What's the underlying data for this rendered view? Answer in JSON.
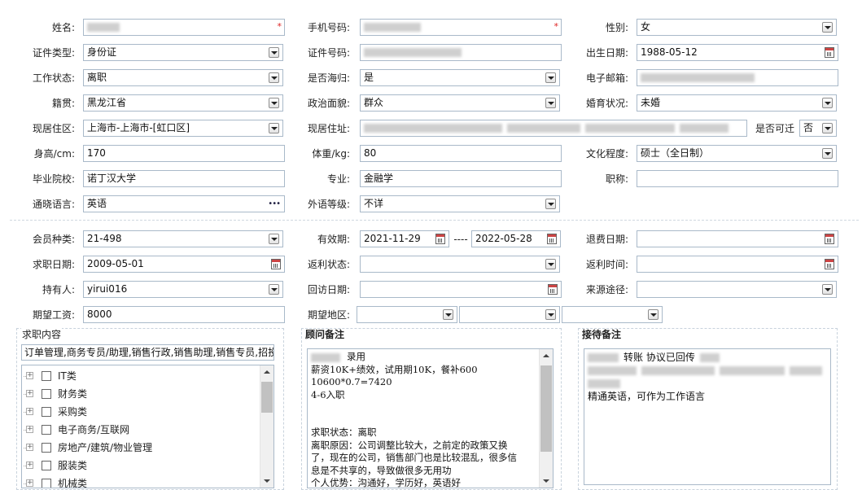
{
  "personal": {
    "name_label": "姓名:",
    "phone_label": "手机号码:",
    "gender_label": "性别:",
    "gender_value": "女",
    "id_type_label": "证件类型:",
    "id_type_value": "身份证",
    "id_number_label": "证件号码:",
    "birth_label": "出生日期:",
    "birth_value": "1988-05-12",
    "work_status_label": "工作状态:",
    "work_status_value": "离职",
    "returnee_label": "是否海归:",
    "returnee_value": "是",
    "email_label": "电子邮箱:",
    "native_label": "籍贯:",
    "native_value": "黑龙江省",
    "political_label": "政治面貌:",
    "political_value": "群众",
    "marital_label": "婚育状况:",
    "marital_value": "未婚",
    "residence_label": "现居住区:",
    "residence_value": "上海市-上海市-[虹口区]",
    "address_label": "现居住址:",
    "relocate_label": "是否可迁",
    "relocate_value": "否",
    "height_label": "身高/cm:",
    "height_value": "170",
    "weight_label": "体重/kg:",
    "weight_value": "80",
    "education_label": "文化程度:",
    "education_value": "硕士（全日制）",
    "school_label": "毕业院校:",
    "school_value": "诺丁汉大学",
    "major_label": "专业:",
    "major_value": "金融学",
    "title_label": "职称:",
    "language_label": "通晓语言:",
    "language_value": "英语",
    "language_more": "•••",
    "foreign_level_label": "外语等级:",
    "foreign_level_value": "不详"
  },
  "membership": {
    "type_label": "会员种类:",
    "type_value": "21-498",
    "valid_label": "有效期:",
    "valid_from": "2021-11-29",
    "valid_sep": "----",
    "valid_to": "2022-05-28",
    "refund_label": "退费日期:",
    "job_date_label": "求职日期:",
    "job_date_value": "2009-05-01",
    "rebate_status_label": "返利状态:",
    "rebate_time_label": "返利时间:",
    "holder_label": "持有人:",
    "holder_value": "yirui016",
    "revisit_label": "回访日期:",
    "source_label": "来源途径:",
    "salary_label": "期望工资:",
    "salary_value": "8000",
    "region_label": "期望地区:"
  },
  "job_panel": {
    "title": "求职内容",
    "selected": "订单管理,商务专员/助理,销售行政,销售助理,销售专员,招投",
    "categories": [
      "IT类",
      "财务类",
      "采购类",
      "电子商务/互联网",
      "房地产/建筑/物业管理",
      "服装类",
      "机械类"
    ]
  },
  "consultant_panel": {
    "title": "顾问备注",
    "line1_suffix": "录用",
    "lines": [
      "薪资10K+绩效，试用期10K，餐补600",
      "10600*0.7=7420",
      "4-6入职",
      "",
      "",
      "求职状态：离职",
      "离职原因：公司调整比较大，之前定的政策又换",
      "了，现在的公司，销售部门也是比较混乱，很多信",
      "息是不共享的，导致做很多无用功",
      "个人优势：沟通好，学历好，英语好"
    ]
  },
  "reception_panel": {
    "title": "接待备注",
    "line1_mid": "转账 协议已回传",
    "line_last": "精通英语，可作为工作语言"
  }
}
